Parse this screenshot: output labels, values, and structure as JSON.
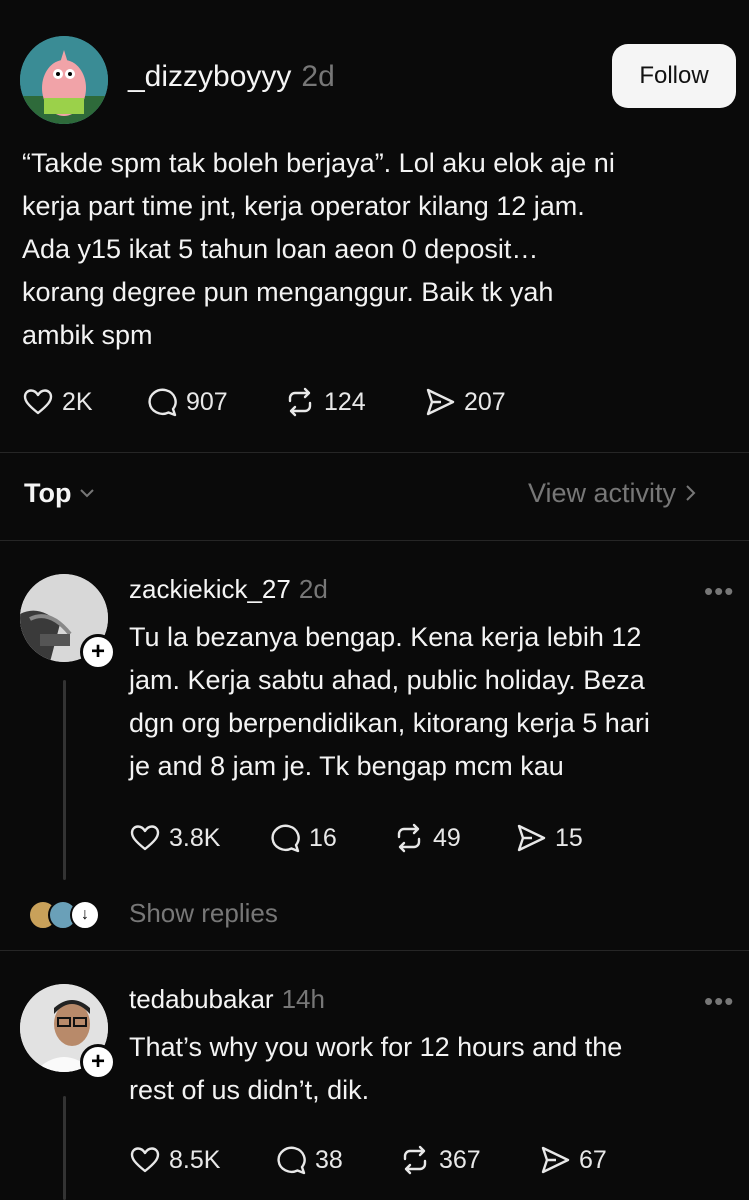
{
  "post": {
    "username": "_dizzyboyyy",
    "time": "2d",
    "follow_label": "Follow",
    "text": "“Takde spm tak boleh berjaya”. Lol aku elok aje ni\nkerja part time jnt, kerja operator kilang 12 jam.\nAda y15 ikat 5 tahun loan aeon 0 deposit…\nkorang degree pun menganggur. Baik tk yah\nambik spm",
    "likes": "2K",
    "comments": "907",
    "reposts": "124",
    "shares": "207"
  },
  "sort": {
    "label": "Top",
    "view_activity": "View activity"
  },
  "replies": [
    {
      "username": "zackiekick_27",
      "time": "2d",
      "text": "Tu la bezanya bengap. Kena kerja lebih 12\njam. Kerja sabtu ahad, public holiday. Beza\ndgn org berpendidikan, kitorang kerja 5 hari\nje and 8 jam je. Tk bengap mcm kau",
      "likes": "3.8K",
      "comments": "16",
      "reposts": "49",
      "shares": "15",
      "show_replies": "Show replies"
    },
    {
      "username": "tedabubakar",
      "time": "14h",
      "text": "That’s why you work for 12 hours and the\nrest of us didn’t, dik.",
      "likes": "8.5K",
      "comments": "38",
      "reposts": "367",
      "shares": "67"
    }
  ],
  "icons": {
    "like": "heart-icon",
    "comment": "comment-bubble-icon",
    "repost": "repost-icon",
    "share": "send-icon",
    "more": "more-dots-icon",
    "sort_chevron": "chevron-down-icon",
    "activity_chevron": "chevron-right-icon"
  },
  "colors": {
    "background": "#0a0a0a",
    "text": "#f3f3f3",
    "muted": "#777777",
    "follow_bg": "#f5f5f5"
  }
}
